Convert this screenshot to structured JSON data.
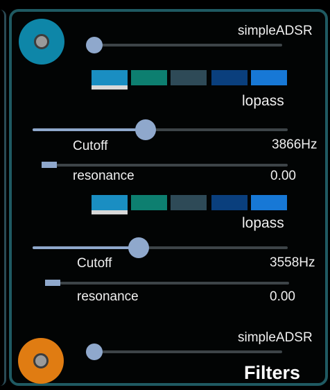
{
  "top_port": {
    "color": "#0e86a8"
  },
  "bottom_port": {
    "color": "#e07c12"
  },
  "top_adsr": {
    "label": "simpleADSR",
    "value": 0.0
  },
  "bottom_adsr": {
    "label": "simpleADSR",
    "value": 0.0
  },
  "filter1": {
    "type_label": "lopass",
    "swatches": [
      "#1a8ec2",
      "#0d7f70",
      "#2e4a57",
      "#0a3f7d",
      "#1778d6"
    ],
    "selected_index": 0,
    "cutoff": {
      "label": "Cutoff",
      "value_text": "3866Hz",
      "fraction": 0.44
    },
    "resonance": {
      "label": "resonance",
      "value_text": "0.00",
      "fraction": 0.0
    }
  },
  "filter2": {
    "type_label": "lopass",
    "swatches": [
      "#1a8ec2",
      "#0d7f70",
      "#2e4a57",
      "#0a3f7d",
      "#1778d6"
    ],
    "selected_index": 0,
    "cutoff": {
      "label": "Cutoff",
      "value_text": "3558Hz",
      "fraction": 0.41
    },
    "resonance": {
      "label": "resonance",
      "value_text": "0.00",
      "fraction": 0.0
    }
  },
  "panel": {
    "title": "Filters",
    "border_color": "#1f5a62"
  }
}
